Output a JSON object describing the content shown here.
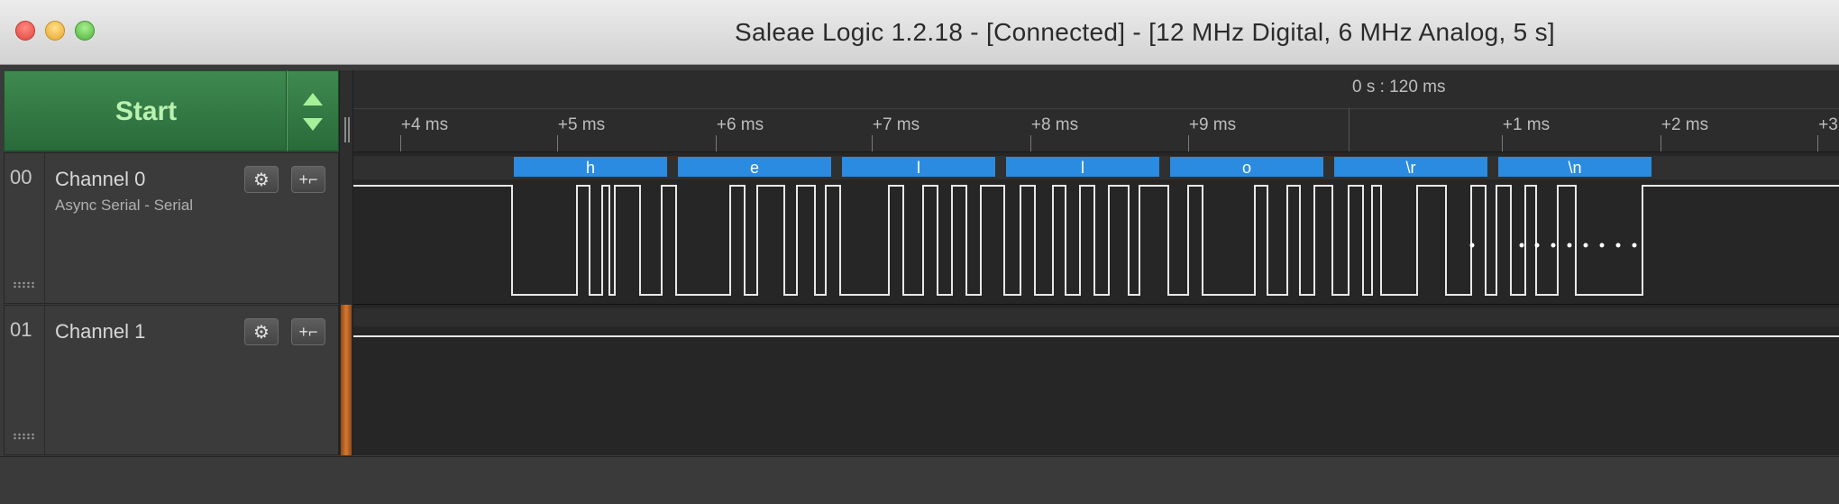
{
  "window": {
    "title": "Saleae Logic 1.2.18 - [Connected] - [12 MHz Digital, 6 MHz Analog, 5 s]",
    "traffic_lights": [
      "close",
      "minimize",
      "zoom"
    ]
  },
  "toolbar": {
    "start_label": "Start",
    "up_icon": "triangle-up-icon",
    "down_icon": "triangle-down-icon"
  },
  "ruler": {
    "origin_label": "0 s : 120 ms",
    "ticks": [
      "+4 ms",
      "+5 ms",
      "+6 ms",
      "+7 ms",
      "+8 ms",
      "+9 ms",
      "+1 ms",
      "+2 ms",
      "+3"
    ]
  },
  "channels": [
    {
      "number": "00",
      "name": "Channel 0",
      "analyzer": "Async Serial - Serial",
      "settings_icon": "gear-icon",
      "trigger_icon": "edge-trigger-icon",
      "decoded": [
        "h",
        "e",
        "l",
        "l",
        "o",
        "\\r",
        "\\n"
      ]
    },
    {
      "number": "01",
      "name": "Channel 1",
      "settings_icon": "gear-icon",
      "trigger_icon": "edge-trigger-icon"
    }
  ],
  "colors": {
    "start_green": "#2f7440",
    "decode_blue": "#2b8be0",
    "wave_white": "#e8e8e8",
    "background": "#262626"
  }
}
